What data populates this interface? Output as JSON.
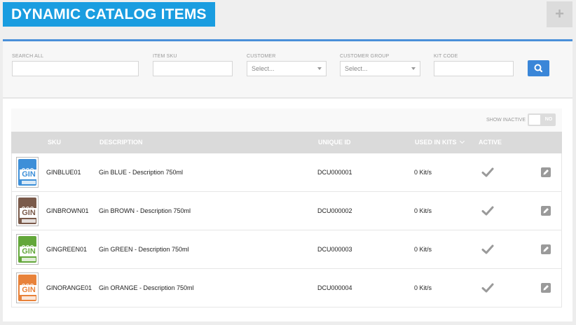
{
  "header": {
    "title": "DYNAMIC CATALOG ITEMS",
    "add_label": "+",
    "accent_color": "#1a9de0"
  },
  "filters": {
    "search_all": {
      "label": "SEARCH ALL",
      "value": ""
    },
    "item_sku": {
      "label": "ITEM SKU",
      "value": ""
    },
    "customer": {
      "label": "CUSTOMER",
      "selected": "Select..."
    },
    "customer_group": {
      "label": "CUSTOMER GROUP",
      "selected": "Select..."
    },
    "kit_code": {
      "label": "KIT CODE",
      "value": ""
    },
    "search_button_icon": "search-icon"
  },
  "show_inactive": {
    "label": "SHOW INACTIVE",
    "toggle_label": "NO"
  },
  "table": {
    "columns": [
      "SKU",
      "DESCRIPTION",
      "UNIQUE ID",
      "USED IN KITS",
      "ACTIVE"
    ],
    "rows": [
      {
        "sku": "GINBLUE01",
        "description": "Gin BLUE - Description 750ml",
        "unique_id": "DCU000001",
        "used_in_kits": "0 Kit/s",
        "label_color": "#3d8fd8",
        "thumb_text": "GIN"
      },
      {
        "sku": "GINBROWN01",
        "description": "Gin BROWN - Description 750ml",
        "unique_id": "DCU000002",
        "used_in_kits": "0 Kit/s",
        "label_color": "#7a5a4a",
        "thumb_text": "GIN"
      },
      {
        "sku": "GINGREEN01",
        "description": "Gin GREEN - Description 750ml",
        "unique_id": "DCU000003",
        "used_in_kits": "0 Kit/s",
        "label_color": "#63a73a",
        "thumb_text": "GIN"
      },
      {
        "sku": "GINORANGE01",
        "description": "Gin ORANGE - Description 750ml",
        "unique_id": "DCU000004",
        "used_in_kits": "0 Kit/s",
        "label_color": "#e8823a",
        "thumb_text": "GIN"
      }
    ]
  }
}
